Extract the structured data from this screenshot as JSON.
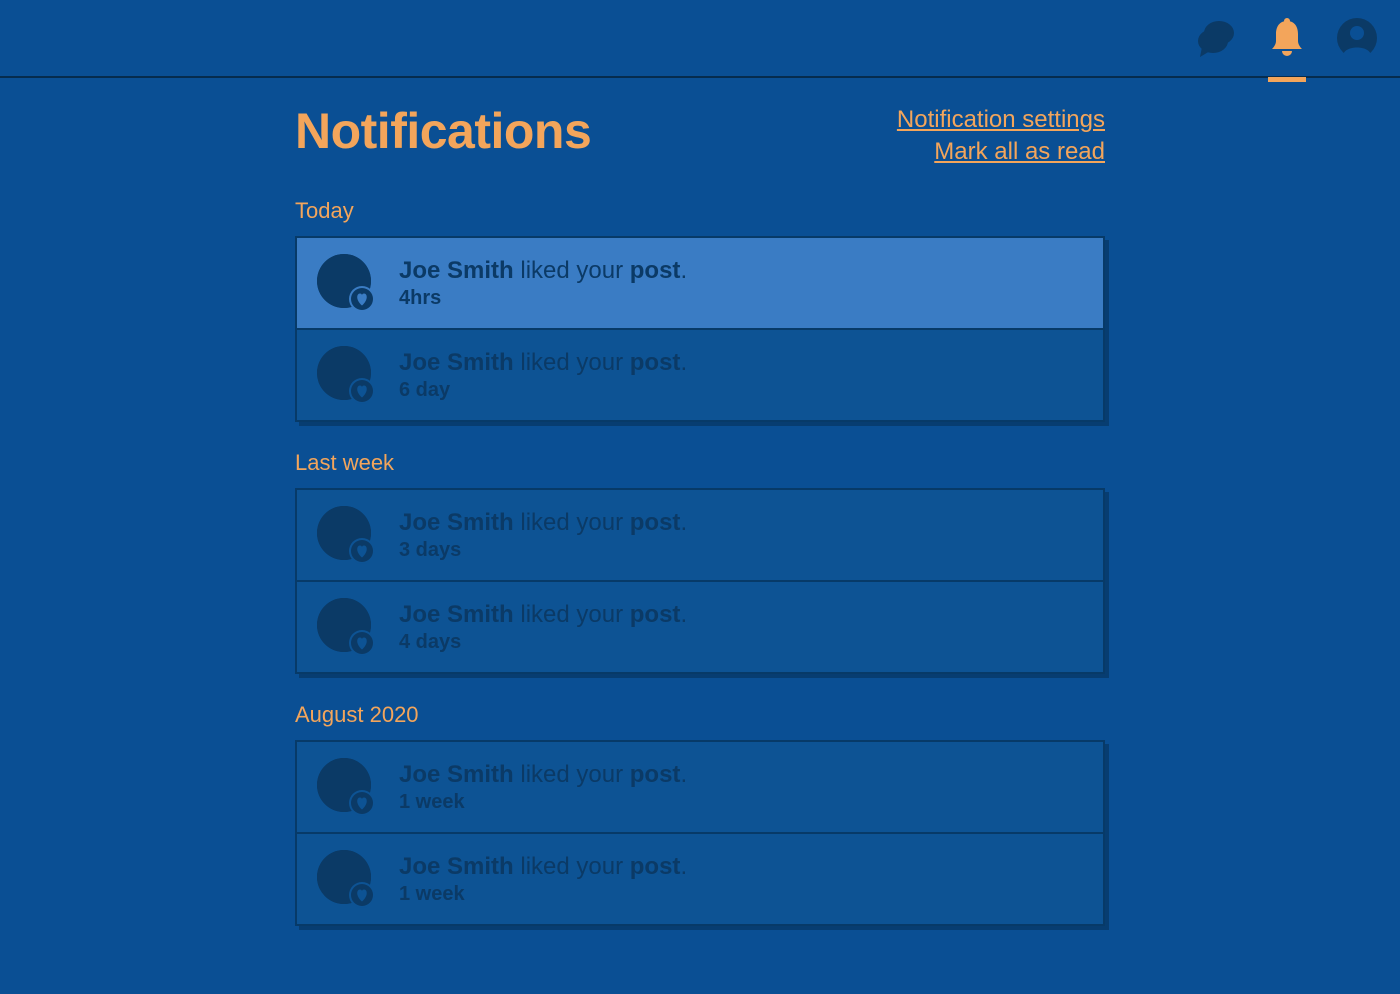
{
  "colors": {
    "accent": "#f3a55b",
    "bg": "#0a4f94",
    "darkText": "#0b3a66",
    "unreadBg": "#3a7cc4"
  },
  "header": {
    "title": "Notifications",
    "settingsLink": "Notification settings",
    "markAllLink": "Mark all as read"
  },
  "sections": [
    {
      "heading": "Today",
      "items": [
        {
          "actor": "Joe Smith",
          "middle": " liked your ",
          "object": "post",
          "suffix": ".",
          "time": "4hrs",
          "unread": true
        },
        {
          "actor": "Joe Smith",
          "middle": " liked your ",
          "object": "post",
          "suffix": ".",
          "time": "6 day",
          "unread": false
        }
      ]
    },
    {
      "heading": "Last week",
      "items": [
        {
          "actor": "Joe Smith",
          "middle": " liked your ",
          "object": "post",
          "suffix": ".",
          "time": "3 days",
          "unread": false
        },
        {
          "actor": "Joe Smith",
          "middle": " liked your ",
          "object": "post",
          "suffix": ".",
          "time": "4 days",
          "unread": false
        }
      ]
    },
    {
      "heading": "August 2020",
      "items": [
        {
          "actor": "Joe Smith",
          "middle": " liked your ",
          "object": "post",
          "suffix": ".",
          "time": "1 week",
          "unread": false
        },
        {
          "actor": "Joe Smith",
          "middle": " liked your ",
          "object": "post",
          "suffix": ".",
          "time": "1 week",
          "unread": false
        }
      ]
    }
  ]
}
